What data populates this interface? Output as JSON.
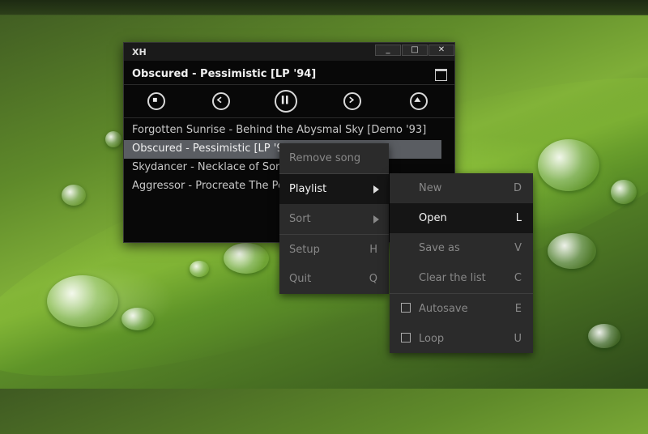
{
  "player": {
    "app_name": "XH",
    "window_buttons": [
      "_",
      "□",
      "✕"
    ],
    "now_playing": "Obscured - Pessimistic [LP '94]",
    "controls": [
      "stop-icon",
      "previous-icon",
      "pause-icon",
      "next-icon",
      "eject-icon"
    ],
    "tracks": [
      "Forgotten Sunrise - Behind the Abysmal Sky [Demo '93]",
      "Obscured - Pessimistic [LP '94]",
      "Skydancer - Necklace of Sorrow [LP '97]",
      "Aggressor - Procreate The Petrified [LP '93]"
    ],
    "selected_index": 1
  },
  "menu": {
    "items": [
      {
        "label": "Remove song",
        "key": ""
      },
      {
        "label": "Playlist",
        "key": ""
      },
      {
        "label": "Sort",
        "key": ""
      },
      {
        "label": "Setup",
        "key": "H"
      },
      {
        "label": "Quit",
        "key": "Q"
      }
    ]
  },
  "submenu": {
    "items": [
      {
        "label": "New",
        "key": "D"
      },
      {
        "label": "Open",
        "key": "L"
      },
      {
        "label": "Save as",
        "key": "V"
      },
      {
        "label": "Clear the list",
        "key": "C"
      },
      {
        "label": "Autosave",
        "key": "E"
      },
      {
        "label": "Loop",
        "key": "U"
      }
    ]
  }
}
